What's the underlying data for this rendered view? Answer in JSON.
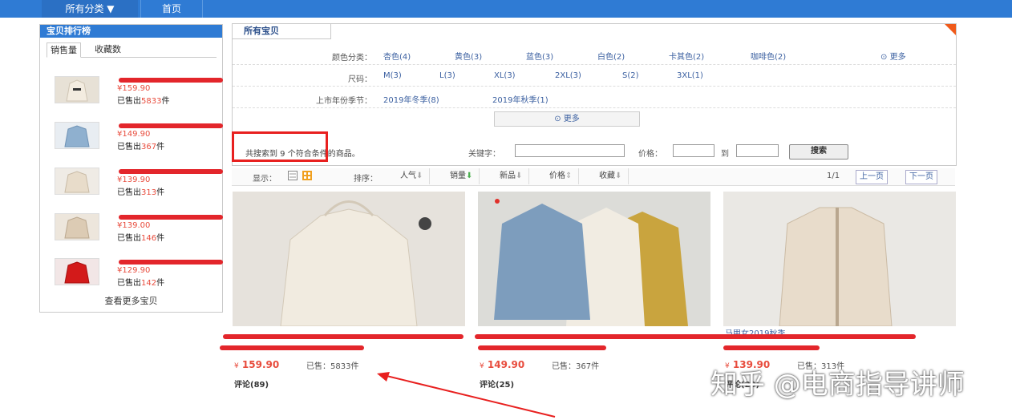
{
  "topnav": {
    "category": "所有分类",
    "home": "首页"
  },
  "rank": {
    "title": "宝贝排行榜",
    "tabs": [
      "销售量",
      "收藏数"
    ],
    "items": [
      {
        "price": "¥159.90",
        "sold_prefix": "已售出",
        "sold": "5833",
        "sold_suffix": "件"
      },
      {
        "price": "¥149.90",
        "sold_prefix": "已售出",
        "sold": "367",
        "sold_suffix": "件"
      },
      {
        "price": "¥139.90",
        "sold_prefix": "已售出",
        "sold": "313",
        "sold_suffix": "件"
      },
      {
        "price": "¥139.00",
        "sold_prefix": "已售出",
        "sold": "146",
        "sold_suffix": "件"
      },
      {
        "price": "¥129.90",
        "sold_prefix": "已售出",
        "sold": "142",
        "sold_suffix": "件"
      }
    ],
    "more": "查看更多宝贝"
  },
  "filter": {
    "title": "所有宝贝",
    "color_label": "颜色分类：",
    "colors": [
      "杏色(4)",
      "黄色(3)",
      "蓝色(3)",
      "白色(2)",
      "卡其色(2)",
      "咖啡色(2)"
    ],
    "color_more": "更多",
    "size_label": "尺码：",
    "sizes": [
      "M(3)",
      "L(3)",
      "XL(3)",
      "2XL(3)",
      "S(2)",
      "3XL(1)"
    ],
    "season_label": "上市年份季节：",
    "seasons": [
      "2019年冬季(8)",
      "2019年秋季(1)"
    ],
    "more_all": "更多",
    "result_text": "共搜索到 9 个符合条件的商品。",
    "keyword_label": "关键字：",
    "price_label": "价格：",
    "to_label": "到",
    "search_button": "搜索"
  },
  "sortbar": {
    "display_label": "显示：",
    "sort_label": "排序：",
    "sorts": [
      "人气",
      "销量",
      "新品",
      "价格",
      "收藏"
    ],
    "page": "1/1",
    "prev": "上一页",
    "next": "下一页"
  },
  "products": [
    {
      "title": "",
      "price_symbol": "¥",
      "price": "159.90",
      "sold": "已售：5833件",
      "comments": "评论(89)"
    },
    {
      "title": "",
      "price_symbol": "¥",
      "price": "149.90",
      "sold": "已售：367件",
      "comments": "评论(25)"
    },
    {
      "title": "马甲女2019秋季",
      "price_symbol": "¥",
      "price": "139.90",
      "sold": "已售：313件",
      "comments": "评论(20)"
    }
  ],
  "watermark": "知乎 @电商指导讲师"
}
